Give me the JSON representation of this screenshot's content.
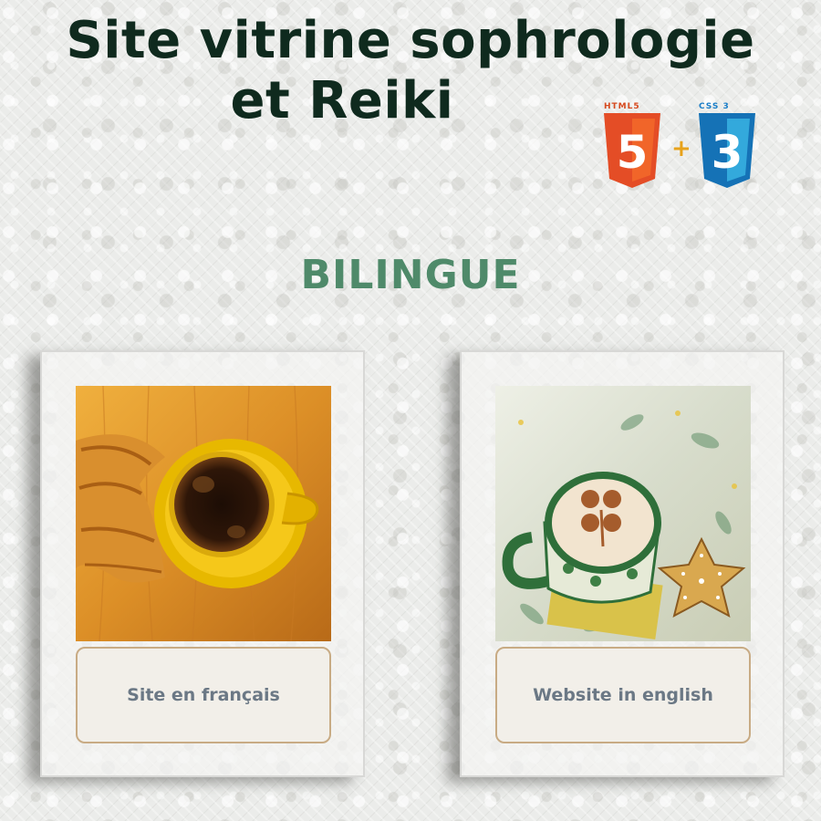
{
  "header": {
    "title_line1": "Site vitrine  sophrologie",
    "title_line2": "et Reiki",
    "tech_badges": {
      "html": {
        "caption": "HTML5",
        "numeral": "5",
        "color": "#e44d26",
        "icon": "html5-badge-icon"
      },
      "plus": "+",
      "css": {
        "caption": "CSS 3",
        "numeral": "3",
        "color": "#1572b6",
        "icon": "css3-badge-icon"
      }
    }
  },
  "subtitle": "BILINGUE",
  "colors": {
    "title": "#0f2a1e",
    "subtitle": "#4f8a6a",
    "button_text": "#6b7885",
    "button_border": "#c8ab84"
  },
  "cards": [
    {
      "image": "coffee-cup-and-croissant-photo",
      "button_label": "Site en français"
    },
    {
      "image": "clover-latte-and-star-cookie-photo",
      "button_label": "Website in english"
    }
  ]
}
